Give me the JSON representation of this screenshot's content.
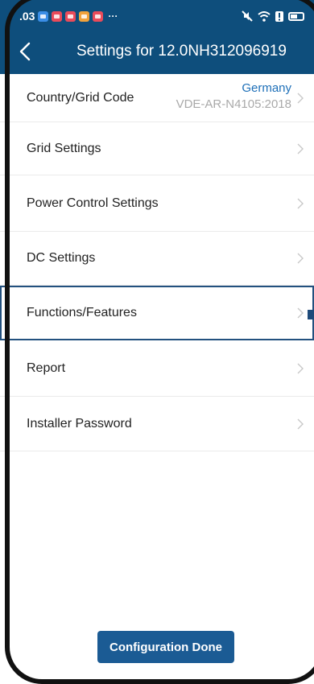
{
  "status_bar": {
    "time": ".03",
    "overflow": "···"
  },
  "header": {
    "title": "Settings for 12.0NH312096919"
  },
  "menu": {
    "items": [
      {
        "label": "Country/Grid Code",
        "value": "Germany",
        "sub_value": "VDE-AR-N4105:2018"
      },
      {
        "label": "Grid Settings"
      },
      {
        "label": "Power Control Settings"
      },
      {
        "label": "DC Settings"
      },
      {
        "label": "Functions/Features"
      },
      {
        "label": "Report"
      },
      {
        "label": "Installer Password"
      }
    ]
  },
  "footer": {
    "button_label": "Configuration Done"
  },
  "colors": {
    "header_bg": "#0e4e7c",
    "value_blue": "#1d6fb8",
    "value_gray": "#a9a9a9",
    "button_bg": "#1b5b94",
    "highlight_border": "#23517f"
  },
  "icons": [
    "back-arrow-icon",
    "chevron-right-icon",
    "mute-icon",
    "wifi-icon",
    "alert-icon",
    "battery-icon"
  ]
}
